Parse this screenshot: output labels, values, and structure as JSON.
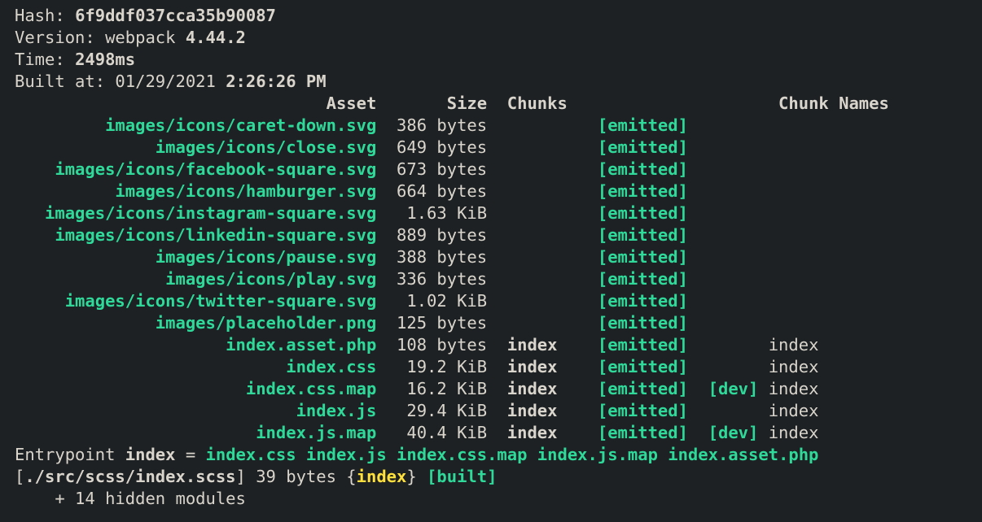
{
  "header": {
    "hash_label": "Hash: ",
    "hash_value": "6f9ddf037cca35b90087",
    "version_label": "Version: webpack ",
    "version_value": "4.44.2",
    "time_label": "Time: ",
    "time_value": "2498ms",
    "built_label": "Built at: 01/29/2021 ",
    "built_value": "2:26:26 PM"
  },
  "columns": {
    "asset": "Asset",
    "size": "Size",
    "chunks": "Chunks",
    "chunk_names": "Chunk Names"
  },
  "status": {
    "emitted": "[emitted]",
    "dev": "[dev]",
    "built": "[built]"
  },
  "assets": [
    {
      "name": "images/icons/caret-down.svg",
      "size": "386 bytes",
      "chunks": "",
      "dev": false,
      "chunk_names": ""
    },
    {
      "name": "images/icons/close.svg",
      "size": "649 bytes",
      "chunks": "",
      "dev": false,
      "chunk_names": ""
    },
    {
      "name": "images/icons/facebook-square.svg",
      "size": "673 bytes",
      "chunks": "",
      "dev": false,
      "chunk_names": ""
    },
    {
      "name": "images/icons/hamburger.svg",
      "size": "664 bytes",
      "chunks": "",
      "dev": false,
      "chunk_names": ""
    },
    {
      "name": "images/icons/instagram-square.svg",
      "size": "1.63 KiB",
      "chunks": "",
      "dev": false,
      "chunk_names": ""
    },
    {
      "name": "images/icons/linkedin-square.svg",
      "size": "889 bytes",
      "chunks": "",
      "dev": false,
      "chunk_names": ""
    },
    {
      "name": "images/icons/pause.svg",
      "size": "388 bytes",
      "chunks": "",
      "dev": false,
      "chunk_names": ""
    },
    {
      "name": "images/icons/play.svg",
      "size": "336 bytes",
      "chunks": "",
      "dev": false,
      "chunk_names": ""
    },
    {
      "name": "images/icons/twitter-square.svg",
      "size": "1.02 KiB",
      "chunks": "",
      "dev": false,
      "chunk_names": ""
    },
    {
      "name": "images/placeholder.png",
      "size": "125 bytes",
      "chunks": "",
      "dev": false,
      "chunk_names": ""
    },
    {
      "name": "index.asset.php",
      "size": "108 bytes",
      "chunks": "index",
      "dev": false,
      "chunk_names": "index"
    },
    {
      "name": "index.css",
      "size": "19.2 KiB",
      "chunks": "index",
      "dev": false,
      "chunk_names": "index"
    },
    {
      "name": "index.css.map",
      "size": "16.2 KiB",
      "chunks": "index",
      "dev": true,
      "chunk_names": "index"
    },
    {
      "name": "index.js",
      "size": "29.4 KiB",
      "chunks": "index",
      "dev": false,
      "chunk_names": "index"
    },
    {
      "name": "index.js.map",
      "size": "40.4 KiB",
      "chunks": "index",
      "dev": true,
      "chunk_names": "index"
    }
  ],
  "entrypoint": {
    "label": "Entrypoint ",
    "name": "index",
    "equals": " = ",
    "files": "index.css index.js index.css.map index.js.map index.asset.php"
  },
  "module": {
    "open": "[",
    "path": "./src/scss/index.scss",
    "close": "]",
    "bytes": " 39 bytes {",
    "chunk": "index",
    "rbrace": "} "
  },
  "hidden": "    + 14 hidden modules"
}
